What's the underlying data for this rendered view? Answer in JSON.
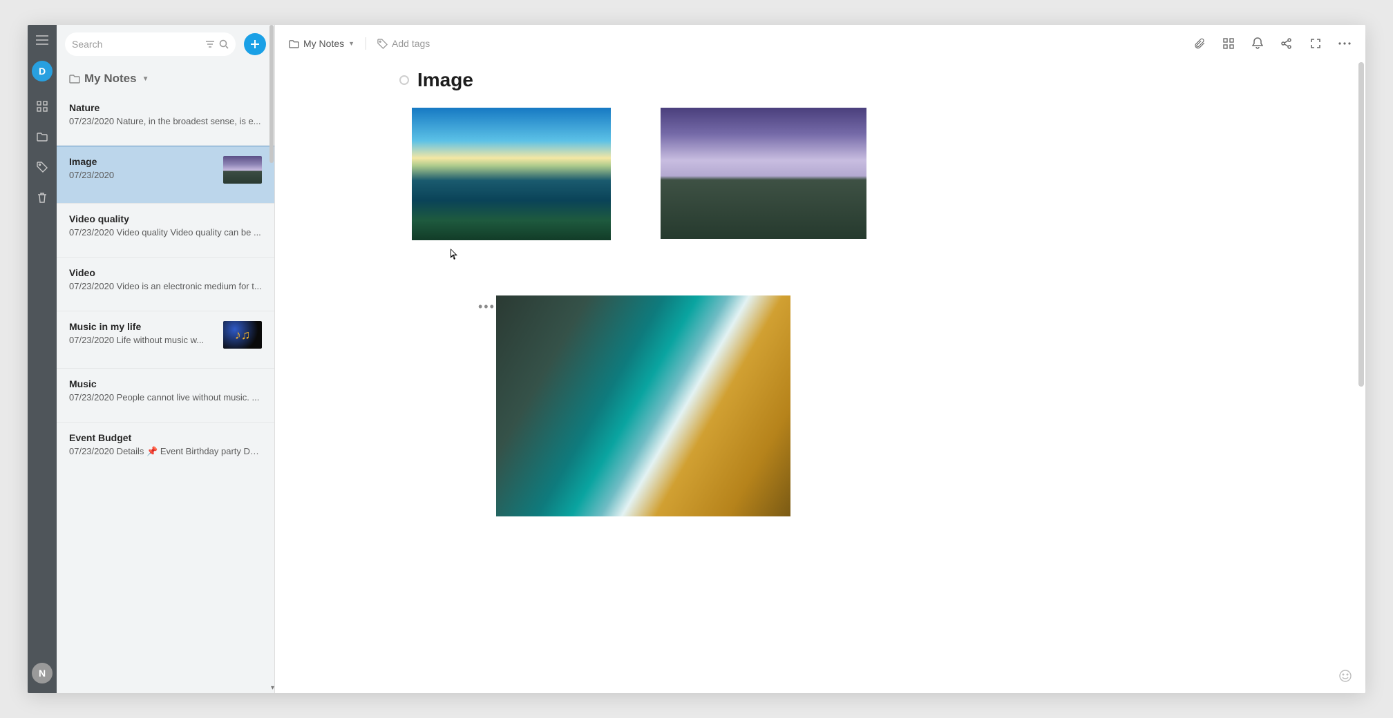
{
  "rail": {
    "avatar_letter": "D",
    "bottom_letter": "N"
  },
  "list": {
    "search_placeholder": "Search",
    "folder_label": "My Notes",
    "notes": [
      {
        "title": "Nature",
        "date": "07/23/2020",
        "preview": "Nature, in the broadest sense, is e...",
        "thumb": ""
      },
      {
        "title": "Image",
        "date": "07/23/2020",
        "preview": "",
        "thumb": "lake"
      },
      {
        "title": "Video quality",
        "date": "07/23/2020",
        "preview": "Video quality Video quality can be ...",
        "thumb": ""
      },
      {
        "title": "Video",
        "date": "07/23/2020",
        "preview": "Video is an electronic medium for t...",
        "thumb": ""
      },
      {
        "title": "Music in my life",
        "date": "07/23/2020",
        "preview": "Life without music w...",
        "thumb": "music"
      },
      {
        "title": "Music",
        "date": "07/23/2020",
        "preview": "People cannot live without music. ...",
        "thumb": ""
      },
      {
        "title": "Event Budget",
        "date": "07/23/2020",
        "preview": "Details 📌 Event Birthday party Da...",
        "thumb": ""
      }
    ],
    "selected_index": 1
  },
  "editor": {
    "breadcrumb": "My Notes",
    "add_tags_label": "Add tags",
    "doc_title": "Image"
  }
}
